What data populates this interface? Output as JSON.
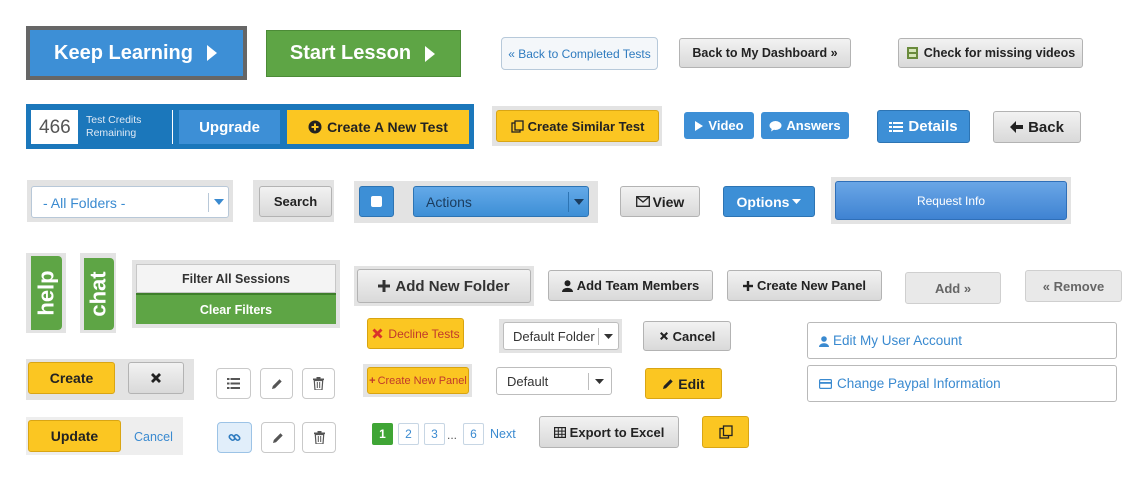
{
  "row1": {
    "keep_learning": "Keep Learning",
    "start_lesson": "Start Lesson",
    "back_completed": "« Back to Completed Tests",
    "back_dashboard": "Back to My Dashboard »",
    "check_videos": "Check for missing videos"
  },
  "row2": {
    "credits_count": "466",
    "credits_label_1": "Test Credits",
    "credits_label_2": "Remaining",
    "upgrade": "Upgrade",
    "create_new_test": "Create A New Test",
    "create_similar_test": "Create Similar Test",
    "video": "Video",
    "answers": "Answers",
    "details": "Details",
    "back": "Back"
  },
  "row3": {
    "folders_select": "- All Folders -",
    "search": "Search",
    "actions": "Actions",
    "view": "View",
    "options": "Options",
    "request_info": "Request Info"
  },
  "side_tabs": {
    "help": "help",
    "chat": "chat"
  },
  "filters": {
    "filter_all": "Filter All Sessions",
    "clear": "Clear Filters"
  },
  "row4": {
    "add_folder": "Add New Folder",
    "add_team": "Add Team Members",
    "create_panel": "Create New Panel",
    "add": "Add »",
    "remove": "« Remove"
  },
  "row5": {
    "decline_tests": "Decline Tests",
    "default_folder": "Default Folder",
    "cancel": "Cancel",
    "edit_account": "Edit My User Account"
  },
  "row6": {
    "create": "Create",
    "create_panel_small": "Create New Panel",
    "default_select": "Default",
    "edit": "Edit",
    "change_paypal": "Change Paypal Information"
  },
  "row7": {
    "update": "Update",
    "cancel_link": "Cancel",
    "pages": [
      "1",
      "2",
      "3",
      "6"
    ],
    "ellipsis": "...",
    "next": "Next",
    "export_excel": "Export to Excel"
  },
  "colors": {
    "blue": "#3d8fd6",
    "green": "#5ea545",
    "yellow": "#fbc622",
    "link": "#2f7bbf"
  }
}
